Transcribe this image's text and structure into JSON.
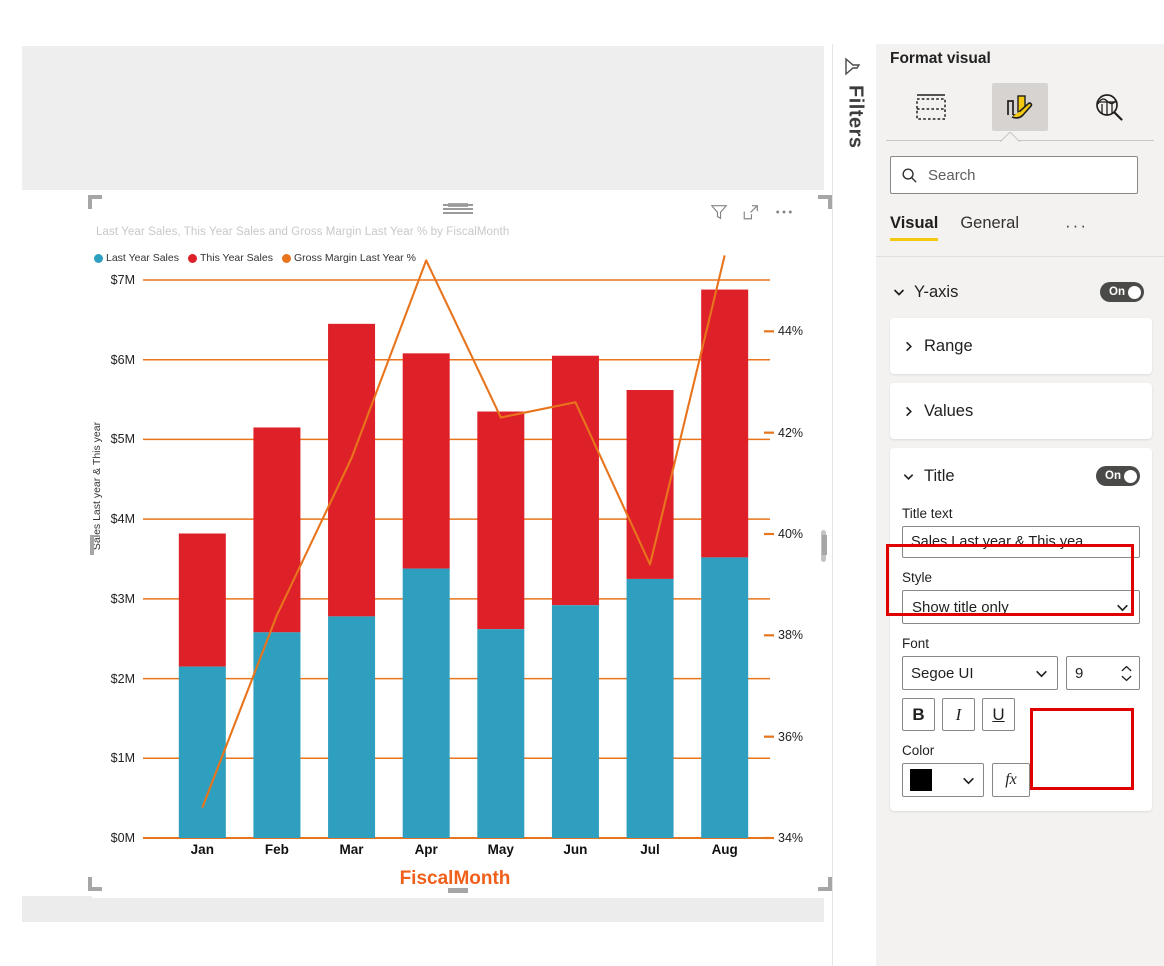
{
  "report": {
    "visual_header_icons": [
      {
        "name": "filter-icon",
        "label": "Filters"
      },
      {
        "name": "focus-mode-icon",
        "label": "Focus mode"
      },
      {
        "name": "more-options-icon",
        "label": "More options"
      }
    ]
  },
  "filters_pane": {
    "label": "Filters",
    "icon": "filter-funnel-icon"
  },
  "format_pane": {
    "title": "Format visual",
    "tabs": [
      {
        "name": "build-visual-tab",
        "icon": "fields-table-icon",
        "active": false
      },
      {
        "name": "format-visual-tab",
        "icon": "paintbrush-chart-icon",
        "active": true
      },
      {
        "name": "analytics-tab",
        "icon": "magnifier-chart-icon",
        "active": false
      }
    ],
    "search": {
      "placeholder": "Search",
      "value": ""
    },
    "subtabs": [
      {
        "label": "Visual",
        "active": true
      },
      {
        "label": "General",
        "active": false
      }
    ],
    "subtab_more": "···",
    "sections": {
      "y_axis": {
        "label": "Y-axis",
        "toggle": "On",
        "cards": [
          {
            "label": "Range",
            "expanded": false
          },
          {
            "label": "Values",
            "expanded": false
          },
          {
            "label": "Title",
            "expanded": true,
            "toggle": "On",
            "title_text": {
              "label": "Title text",
              "value": "Sales Last year & This yea"
            },
            "style": {
              "label": "Style",
              "value": "Show title only"
            },
            "font": {
              "label": "Font",
              "family": "Segoe UI",
              "size": "9",
              "bold_label": "B",
              "italic_label": "I",
              "underline_label": "U"
            },
            "color": {
              "label": "Color",
              "value": "#000000",
              "fx_label": "fx"
            }
          }
        ]
      }
    }
  },
  "chart_data": {
    "type": "bar",
    "title": "Last Year Sales, This Year Sales and Gross Margin Last Year % by FiscalMonth",
    "xlabel": "FiscalMonth",
    "ylabel": "Sales Last year & This year",
    "y2label": "Gross Margin Last Year %",
    "categories": [
      "Jan",
      "Feb",
      "Mar",
      "Apr",
      "May",
      "Jun",
      "Jul",
      "Aug"
    ],
    "stacked": true,
    "grid": true,
    "legend_position": "top-left",
    "series": [
      {
        "name": "Last Year Sales",
        "kind": "bar",
        "color": "#2E9FBE",
        "axis": "left",
        "values": [
          2.15,
          2.58,
          2.78,
          3.38,
          2.62,
          2.92,
          3.25,
          3.52
        ]
      },
      {
        "name": "This Year Sales",
        "kind": "bar",
        "color": "#DE2129",
        "axis": "left",
        "values": [
          1.67,
          2.57,
          3.67,
          2.7,
          2.73,
          3.13,
          2.37,
          3.36
        ]
      },
      {
        "name": "Gross Margin Last Year %",
        "kind": "line",
        "color": "#E8741C",
        "axis": "right",
        "values": [
          34.6,
          38.4,
          41.5,
          45.4,
          42.3,
          42.6,
          39.4,
          45.5
        ]
      }
    ],
    "stack_totals": [
      3.82,
      5.15,
      6.45,
      6.08,
      5.35,
      6.05,
      5.62,
      6.88
    ],
    "ylim": [
      0,
      7
    ],
    "ylabels": [
      "$0M",
      "$1M",
      "$2M",
      "$3M",
      "$4M",
      "$5M",
      "$6M",
      "$7M"
    ],
    "yticks": [
      0,
      1,
      2,
      3,
      4,
      5,
      6,
      7
    ],
    "y2lim": [
      34,
      46
    ],
    "y2labels": [
      "34%",
      "36%",
      "38%",
      "40%",
      "42%",
      "44%"
    ],
    "y2ticks": [
      34,
      36,
      38,
      40,
      42,
      44
    ],
    "colors": {
      "last_year": "#2E9FBE",
      "this_year": "#DE2129",
      "gross_margin": "#E8741C",
      "gridline": "#E8741C",
      "xaxis_title": "#F0601B"
    }
  }
}
